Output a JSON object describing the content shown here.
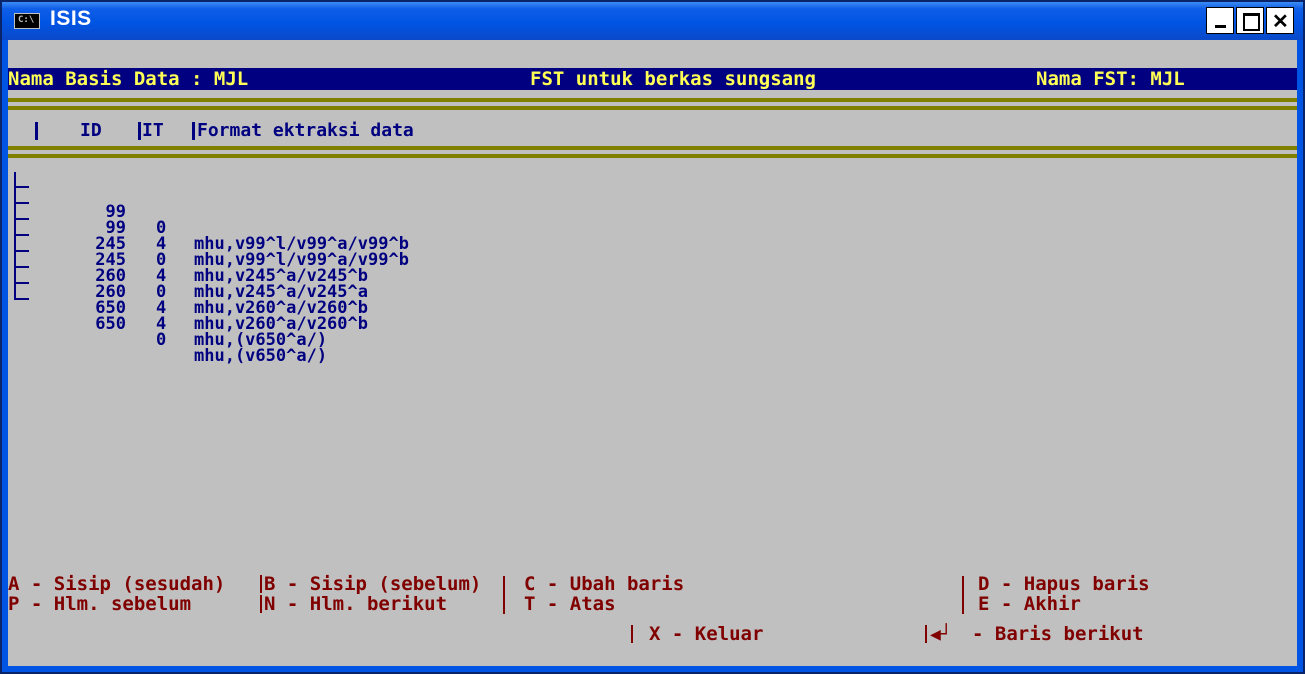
{
  "window": {
    "title": "ISIS",
    "icon": "console-icon",
    "icon_text": "C:\\"
  },
  "header": {
    "db_name": "Nama Basis Data : MJL",
    "fst_title": "FST untuk berkas sungsang",
    "fst_name": "Nama FST: MJL"
  },
  "columns": {
    "id": "ID",
    "it": "IT",
    "format": "Format ektraksi data"
  },
  "rows": [
    {
      "id": "99",
      "it": "0",
      "format": "mhu,v99^l/v99^a/v99^b"
    },
    {
      "id": "99",
      "it": "4",
      "format": "mhu,v99^l/v99^a/v99^b"
    },
    {
      "id": "245",
      "it": "0",
      "format": "mhu,v245^a/v245^b"
    },
    {
      "id": "245",
      "it": "4",
      "format": "mhu,v245^a/v245^a"
    },
    {
      "id": "260",
      "it": "0",
      "format": "mhu,v260^a/v260^b"
    },
    {
      "id": "260",
      "it": "4",
      "format": "mhu,v260^a/v260^b"
    },
    {
      "id": "650",
      "it": "4",
      "format": "mhu,(v650^a/)"
    },
    {
      "id": "650",
      "it": "0",
      "format": "mhu,(v650^a/)"
    }
  ],
  "commands": {
    "a": "A - Sisip (sesudah)",
    "b": "B - Sisip (sebelum)",
    "c": "C - Ubah baris",
    "d": "D - Hapus baris",
    "p": "P - Hlm. sebelum",
    "n": "N - Hlm. berikut",
    "t": "T - Atas",
    "e": "E - Akhir",
    "x": "X - Keluar",
    "enter": "- Baris berikut"
  },
  "colors": {
    "background": "#c0c0c0",
    "header_bg": "#000080",
    "header_text": "#ffff55",
    "row_text": "#000080",
    "command_text": "#800000",
    "rule": "#808000"
  }
}
